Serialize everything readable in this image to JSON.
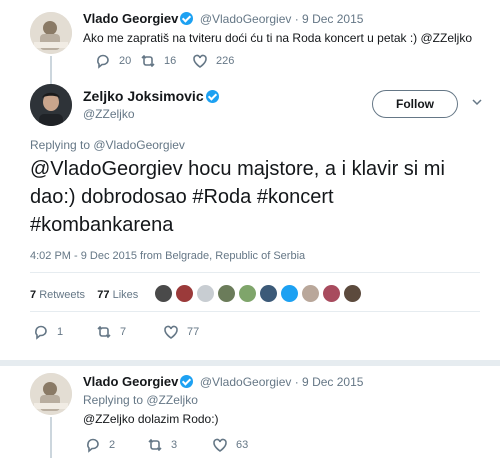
{
  "tweet1": {
    "name": "Vlado Georgiev",
    "handle_time": "@VladoGeorgiev · 9 Dec 2015",
    "text": "Ako me zapratiš na tviteru doći ću ti na Roda koncert u petak :) @ZZeljko",
    "replies": "20",
    "retweets": "16",
    "likes": "226"
  },
  "main": {
    "name": "Zeljko Joksimovic",
    "handle": "@ZZeljko",
    "follow_label": "Follow",
    "replying_to": "Replying to @VladoGeorgiev",
    "text": "@VladoGeorgiev hocu majstore, a i klavir si mi dao:) dobrodosao #Roda #koncert #kombankarena",
    "timestamp": "4:02 PM - 9 Dec 2015 from Belgrade, Republic of Serbia",
    "retweets_count": "7",
    "retweets_label": "Retweets",
    "likes_count": "77",
    "likes_label": "Likes",
    "replies": "1",
    "retweets": "7",
    "likes": "77"
  },
  "tweet3": {
    "name": "Vlado Georgiev",
    "handle_time": "@VladoGeorgiev · 9 Dec 2015",
    "replying_to": "Replying to @ZZeljko",
    "text": "@ZZeljko dolazim Rodo:)",
    "replies": "2",
    "retweets": "3",
    "likes": "63"
  },
  "colors": {
    "accent": "#1da1f2",
    "muted": "#657786",
    "text": "#14171a"
  },
  "likers": [
    "liker-1",
    "liker-2",
    "liker-3",
    "liker-4",
    "liker-5",
    "liker-6",
    "liker-7",
    "liker-8",
    "liker-9",
    "liker-10"
  ]
}
